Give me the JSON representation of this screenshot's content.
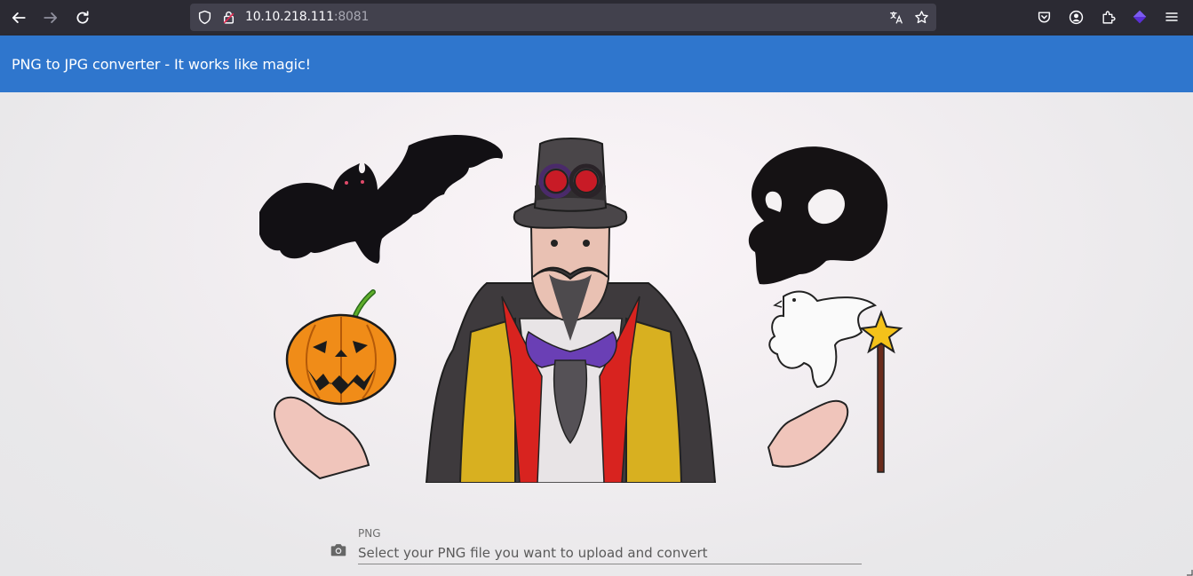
{
  "browser": {
    "url_host": "10.10.218.111",
    "url_port": ":8081"
  },
  "app": {
    "title": "PNG to JPG converter - It works like magic!"
  },
  "hero": {
    "image_alt": "Magician with bat, skull, pumpkin, dove and wand"
  },
  "upload": {
    "label": "PNG",
    "placeholder": "Select your PNG file you want to upload and convert"
  },
  "icons": [
    "back-icon",
    "forward-icon",
    "reload-icon",
    "shield-icon",
    "lock-icon",
    "translate-icon",
    "star-icon",
    "pocket-icon",
    "account-icon",
    "extensions-icon",
    "extension-gem-icon",
    "menu-icon",
    "camera-icon"
  ]
}
